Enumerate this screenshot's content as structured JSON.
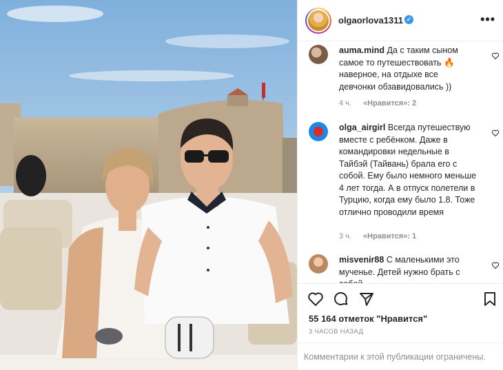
{
  "post": {
    "username": "olgaorlova1311",
    "verified_icon": "verified-badge-icon",
    "more_label": "•••"
  },
  "comments": [
    {
      "username": "auma.mind",
      "text": "Да с таким сыном самое то путешествовать 🔥 наверное, на отдыхе все девчонки обзавидовались ))",
      "age": "4 ч.",
      "likes": "«Нравится»: 2"
    },
    {
      "username": "olga_airgirl",
      "text": "Всегда путешествую вместе с ребёнком. Даже в командировки недельные в Тайбэй (Тайвань) брала его с собой. Ему было немного меньше 4 лет тогда. А в отпуск полетели в Турцию, когда ему было 1.8. Тоже отлично проводили время",
      "age": "3 ч.",
      "likes": "«Нравится»: 1"
    },
    {
      "username": "misvenir88",
      "text": "С маленькими это мученье. Детей нужно брать с собой",
      "age": "",
      "likes": ""
    }
  ],
  "actions": {
    "likes_count": "55 164 отметок \"Нравится\"",
    "time_ago": "3 ЧАСОВ НАЗАД",
    "comments_limited": "Комментарии к этой публикации ограничены."
  },
  "colors": {
    "text": "#262626",
    "secondary": "#8e8e8e",
    "border": "#efefef",
    "verified": "#3897f0"
  }
}
